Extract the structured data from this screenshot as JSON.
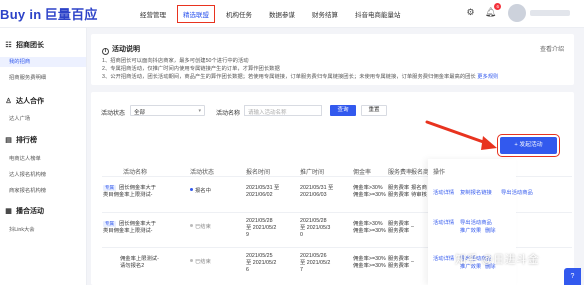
{
  "brand": {
    "logo_text": "Buy in",
    "logo_cn": "巨量百应"
  },
  "nav": [
    {
      "label": "经营管理"
    },
    {
      "label": "精选联盟"
    },
    {
      "label": "机构任务"
    },
    {
      "label": "数据参谋"
    },
    {
      "label": "财务结算"
    },
    {
      "label": "抖音电商能量站"
    }
  ],
  "topbar": {
    "notification_count": "6"
  },
  "sidebar": {
    "groups": [
      {
        "label": "招商团长",
        "icon": "people-icon",
        "items": [
          {
            "label": "我的招商"
          },
          {
            "label": "招商服务费明细"
          }
        ]
      },
      {
        "label": "达人合作",
        "icon": "user-icon",
        "items": [
          {
            "label": "达人广场"
          }
        ]
      },
      {
        "label": "排行榜",
        "icon": "ranking-icon",
        "items": [
          {
            "label": "电商达人榜单"
          },
          {
            "label": "达人报名机构榜"
          },
          {
            "label": "商家报名机构榜"
          }
        ]
      },
      {
        "label": "播合活动",
        "icon": "grid-icon",
        "items": [
          {
            "label": "抖Link大会"
          }
        ]
      }
    ]
  },
  "notice": {
    "title": "活动说明",
    "more": "查看介绍",
    "lines": [
      "1、招商团长可以面向抖店商家，最多可创建50个进行中的活动",
      "2、专属招商活动，仅推广时间内使用专属链接产生的订单，才算作团长数据",
      "3、公开招商活动，团长活动期间，商品产生的算作团长数据；若使用专属链接，订单服务费归专属链接团长；未使用专属链接，订单服务费归佣金率最高的团长"
    ],
    "more_rules": "更多规则"
  },
  "filters": {
    "status_label": "活动状态",
    "status_value": "全部",
    "name_label": "活动名称",
    "name_placeholder": "请输入活动名称",
    "query_button": "查询",
    "reset_button": "重置"
  },
  "launch_button": "+ 发起活动",
  "table": {
    "headers": [
      "活动名称",
      "活动状态",
      "报名时间",
      "推广时间",
      "佣金率",
      "服务费率",
      "报名商",
      "操作"
    ],
    "rows": [
      {
        "tag": "专属",
        "name": [
          "团长佣金率大于",
          "类目佣金率上限测试-"
        ],
        "status": "报名中",
        "status_color": "#3259ee",
        "signup": [
          "2021/05/31 至",
          "2021/06/02"
        ],
        "promo": [
          "2021/05/31 至",
          "2021/06/03"
        ],
        "commission": [
          "佣金率>30%",
          "佣金率>=30%"
        ],
        "service": [
          "服务费率",
          "服务费率"
        ],
        "applicants": [
          "报名商",
          "待审核"
        ],
        "ops": [
          "活动详情",
          "复制报名链接",
          "导出活动商品"
        ]
      },
      {
        "tag": "专属",
        "name": [
          "团长佣金率大于",
          "类目佣金率上限测试-"
        ],
        "status": "已结束",
        "status_color": "#bbbbbb",
        "signup": [
          "2021/05/28",
          "至 2021/05/2",
          "9"
        ],
        "promo": [
          "2021/05/28",
          "至 2021/05/3",
          "0"
        ],
        "commission": [
          "佣金率>30%",
          "佣金率>=30%"
        ],
        "service": [
          "服务费率",
          "服务费率"
        ],
        "applicants": [
          "–"
        ],
        "ops": [
          "活动详情",
          "导出活动商品",
          "推广效果",
          "删除"
        ]
      },
      {
        "tag": "",
        "name": [
          "佣金率上限测试-",
          "请勿报名2"
        ],
        "status": "已结束",
        "status_color": "#bbbbbb",
        "signup": [
          "2021/05/25",
          "至 2021/05/2",
          "6"
        ],
        "promo": [
          "2021/05/26",
          "至 2021/05/2",
          "7"
        ],
        "commission": [
          "佣金率>=30%",
          "佣金率>=30%"
        ],
        "service": [
          "服务费率",
          "服务费率"
        ],
        "applicants": [
          "–"
        ],
        "ops": [
          "活动详情",
          "导出活动商品",
          "推广效果",
          "删除"
        ]
      }
    ]
  },
  "watermark": "知乎 @日进斗金"
}
